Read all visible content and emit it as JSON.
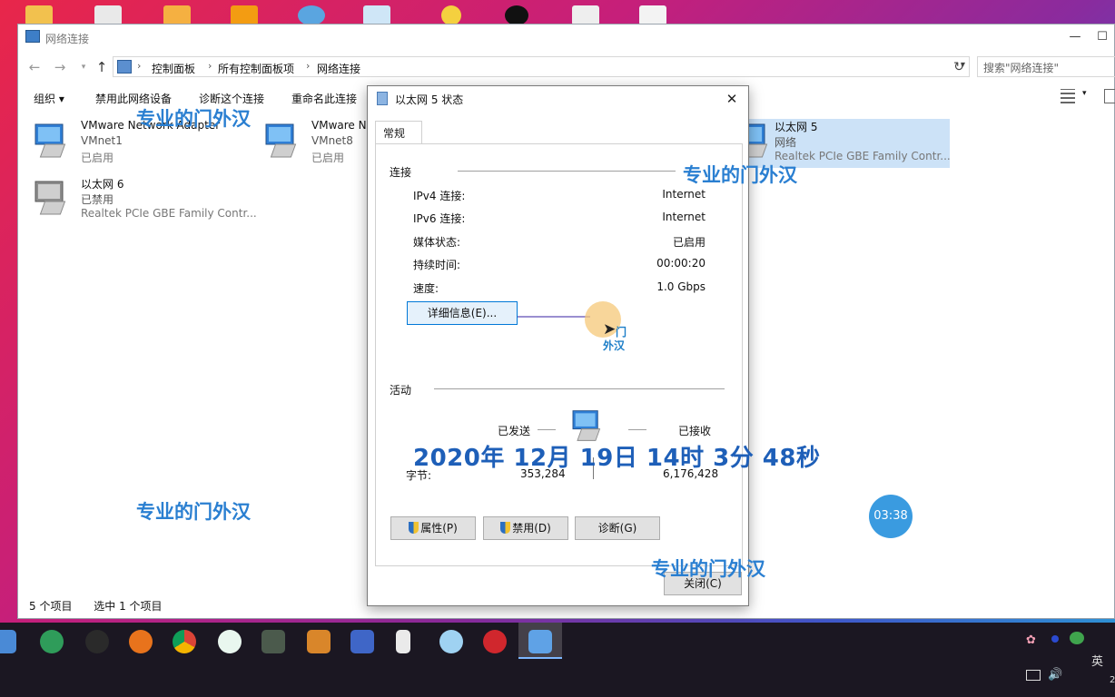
{
  "window": {
    "title": "网络连接",
    "minimize": "—",
    "maximize": "☐"
  },
  "address": {
    "crumbs": [
      "控制面板",
      "所有控制面板项",
      "网络连接"
    ],
    "search_placeholder": "搜索\"网络连接\""
  },
  "toolbar": {
    "organize": "组织 ▾",
    "disable": "禁用此网络设备",
    "diagnose": "诊断这个连接",
    "rename": "重命名此连接"
  },
  "connections": [
    {
      "name": "VMware Network Adapter",
      "line2": "VMnet1",
      "line3": "已启用"
    },
    {
      "name": "VMware N",
      "line2": "VMnet8",
      "line3": "已启用"
    },
    {
      "name": "以太网 5",
      "line2": "网络",
      "line3": "Realtek PCIe GBE Family Contr..."
    },
    {
      "name": "以太网 6",
      "line2": "已禁用",
      "line3": "Realtek PCIe GBE Family Contr..."
    }
  ],
  "status": {
    "count": "5 个项目",
    "selected": "选中 1 个项目"
  },
  "dialog": {
    "title": "以太网 5 状态",
    "tab": "常规",
    "connection_section": "连接",
    "rows": [
      {
        "label": "IPv4 连接:",
        "value": "Internet"
      },
      {
        "label": "IPv6 连接:",
        "value": "Internet"
      },
      {
        "label": "媒体状态:",
        "value": "已启用"
      },
      {
        "label": "持续时间:",
        "value": "00:00:20"
      },
      {
        "label": "速度:",
        "value": "1.0 Gbps"
      }
    ],
    "details_button": "详细信息(E)...",
    "activity_section": "活动",
    "sent_label": "已发送",
    "received_label": "已接收",
    "bytes_label": "字节:",
    "bytes_sent": "353,284",
    "bytes_received": "6,176,428",
    "properties_button": "属性(P)",
    "disable_button": "禁用(D)",
    "diagnose_button": "诊断(G)",
    "close_button": "关闭(C)"
  },
  "overlay": {
    "watermark": "专业的门外汉",
    "date": "2020年 12月 19日 14时 3分 48秒",
    "cursor_label_1": "门",
    "cursor_label_2": "外汉",
    "timer": "03:38"
  },
  "taskbar": {
    "ime": "英",
    "clock_partial": "2"
  }
}
